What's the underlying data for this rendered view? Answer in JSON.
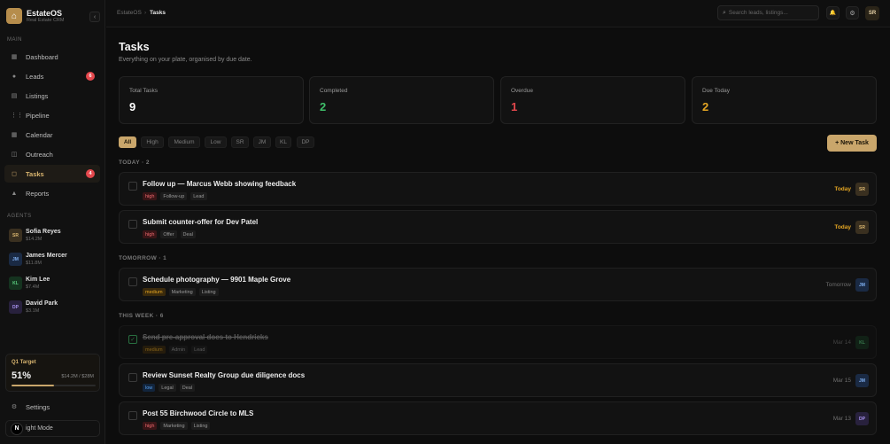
{
  "brand": {
    "name": "EstateOS",
    "subtitle": "Real Estate CRM",
    "logo_icon": "home-icon",
    "collapse_glyph": "‹"
  },
  "sidebar": {
    "main_label": "MAIN",
    "items": [
      {
        "label": "Dashboard",
        "icon": "grid-icon",
        "glyph": "▦"
      },
      {
        "label": "Leads",
        "icon": "leads-icon",
        "glyph": "●",
        "badge": "6"
      },
      {
        "label": "Listings",
        "icon": "listings-icon",
        "glyph": "▤"
      },
      {
        "label": "Pipeline",
        "icon": "pipeline-icon",
        "glyph": "⋮⋮"
      },
      {
        "label": "Calendar",
        "icon": "calendar-icon",
        "glyph": "▦"
      },
      {
        "label": "Outreach",
        "icon": "outreach-icon",
        "glyph": "◫"
      },
      {
        "label": "Tasks",
        "icon": "tasks-icon",
        "glyph": "◻",
        "badge": "4",
        "active": true
      },
      {
        "label": "Reports",
        "icon": "reports-icon",
        "glyph": "▲"
      }
    ],
    "agents_label": "AGENTS",
    "agents": [
      {
        "initials": "SR",
        "name": "Sofia Reyes",
        "volume": "$14.2M"
      },
      {
        "initials": "JM",
        "name": "James Mercer",
        "volume": "$11.8M"
      },
      {
        "initials": "KL",
        "name": "Kim Lee",
        "volume": "$7.4M"
      },
      {
        "initials": "DP",
        "name": "David Park",
        "volume": "$3.1M"
      }
    ],
    "target": {
      "label": "Q1 Target",
      "percent": "51%",
      "amount": "$14.2M / $28M",
      "progress": 0.51
    },
    "settings": {
      "label": "Settings",
      "glyph": "⚙"
    },
    "mode": {
      "badge": "N",
      "label": "ight Mode"
    }
  },
  "topbar": {
    "breadcrumb_root": "EstateOS",
    "breadcrumb_sep": "›",
    "breadcrumb_current": "Tasks",
    "search_placeholder": "Search leads, listings...",
    "search_glyph": "⌕",
    "bell_glyph": "🔔",
    "gear_glyph": "⚙",
    "user_initials": "SR"
  },
  "page": {
    "title": "Tasks",
    "subtitle": "Everything on your plate, organised by due date."
  },
  "stats": [
    {
      "label": "Total Tasks",
      "value": "9",
      "color": "#ffffff"
    },
    {
      "label": "Completed",
      "value": "2",
      "color": "#3fbf6a"
    },
    {
      "label": "Overdue",
      "value": "1",
      "color": "#e5484d"
    },
    {
      "label": "Due Today",
      "value": "2",
      "color": "#e5a623"
    }
  ],
  "filters": [
    "All",
    "High",
    "Medium",
    "Low",
    "SR",
    "JM",
    "KL",
    "DP"
  ],
  "new_task_label": "+ New Task",
  "groups": {
    "today": "TODAY · 2",
    "tomorrow": "TOMORROW · 1",
    "this_week": "THIS WEEK · 6"
  },
  "tasks": [
    {
      "title": "Follow up — Marcus Webb showing feedback",
      "priority": "high",
      "tags": [
        "Follow-up",
        "Lead"
      ],
      "due": "Today",
      "assignee": "SR",
      "done": false
    },
    {
      "title": "Submit counter-offer for Dev Patel",
      "priority": "high",
      "tags": [
        "Offer",
        "Deal"
      ],
      "due": "Today",
      "assignee": "SR",
      "done": false
    },
    {
      "title": "Schedule photography — 9901 Maple Grove",
      "priority": "medium",
      "tags": [
        "Marketing",
        "Listing"
      ],
      "due": "Tomorrow",
      "assignee": "JM",
      "done": false
    },
    {
      "title": "Send pre-approval docs to Hendricks",
      "priority": "medium",
      "tags": [
        "Admin",
        "Lead"
      ],
      "due": "Mar 14",
      "assignee": "KL",
      "done": true,
      "check_glyph": "✓"
    },
    {
      "title": "Review Sunset Realty Group due diligence docs",
      "priority": "low",
      "tags": [
        "Legal",
        "Deal"
      ],
      "due": "Mar 15",
      "assignee": "JM",
      "done": false
    },
    {
      "title": "Post 55 Birchwood Circle to MLS",
      "priority": "high",
      "tags": [
        "Marketing",
        "Listing"
      ],
      "due": "Mar 13",
      "assignee": "DP",
      "done": false
    }
  ],
  "colors": {
    "accent": "#c9a66b",
    "danger": "#e5484d",
    "success": "#3fbf6a",
    "warning": "#e5a623"
  }
}
